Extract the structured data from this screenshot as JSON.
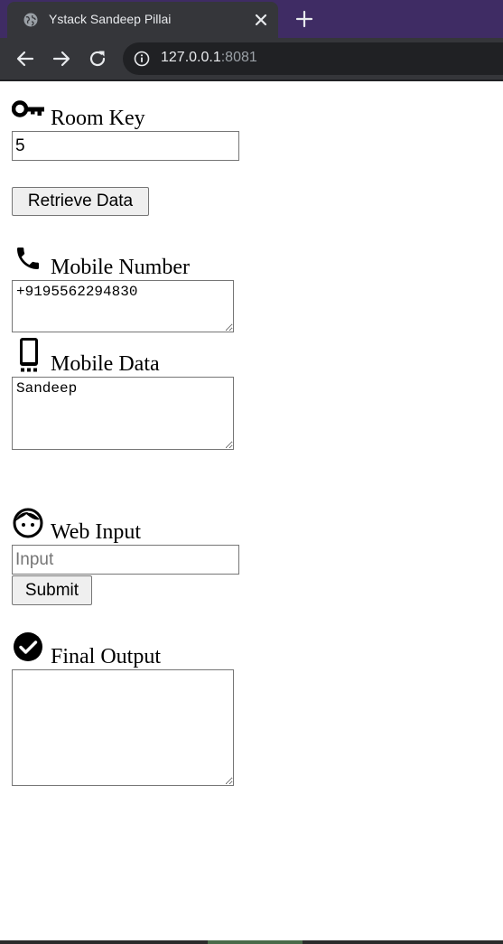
{
  "browser": {
    "tab": {
      "title": "Ystack Sandeep Pillai"
    },
    "url": {
      "host": "127.0.0.1",
      "port": ":8081"
    },
    "colors": {
      "tabstrip": "#3f2c64",
      "toolbar": "#35363a"
    }
  },
  "page": {
    "room_key": {
      "icon": "key-icon",
      "label": "Room Key",
      "value": "5"
    },
    "retrieve_button": {
      "label": "Retrieve Data"
    },
    "mobile_number": {
      "icon": "phone-icon",
      "label": "Mobile Number",
      "value": "+9195562294830"
    },
    "mobile_data": {
      "icon": "smartphone-icon",
      "label": "Mobile Data",
      "value": "Sandeep"
    },
    "web_input": {
      "icon": "face-icon",
      "label": "Web Input",
      "value": "",
      "placeholder": "Input"
    },
    "submit_button": {
      "label": "Submit"
    },
    "final_output": {
      "icon": "check-circle-icon",
      "label": "Final Output",
      "value": ""
    }
  }
}
